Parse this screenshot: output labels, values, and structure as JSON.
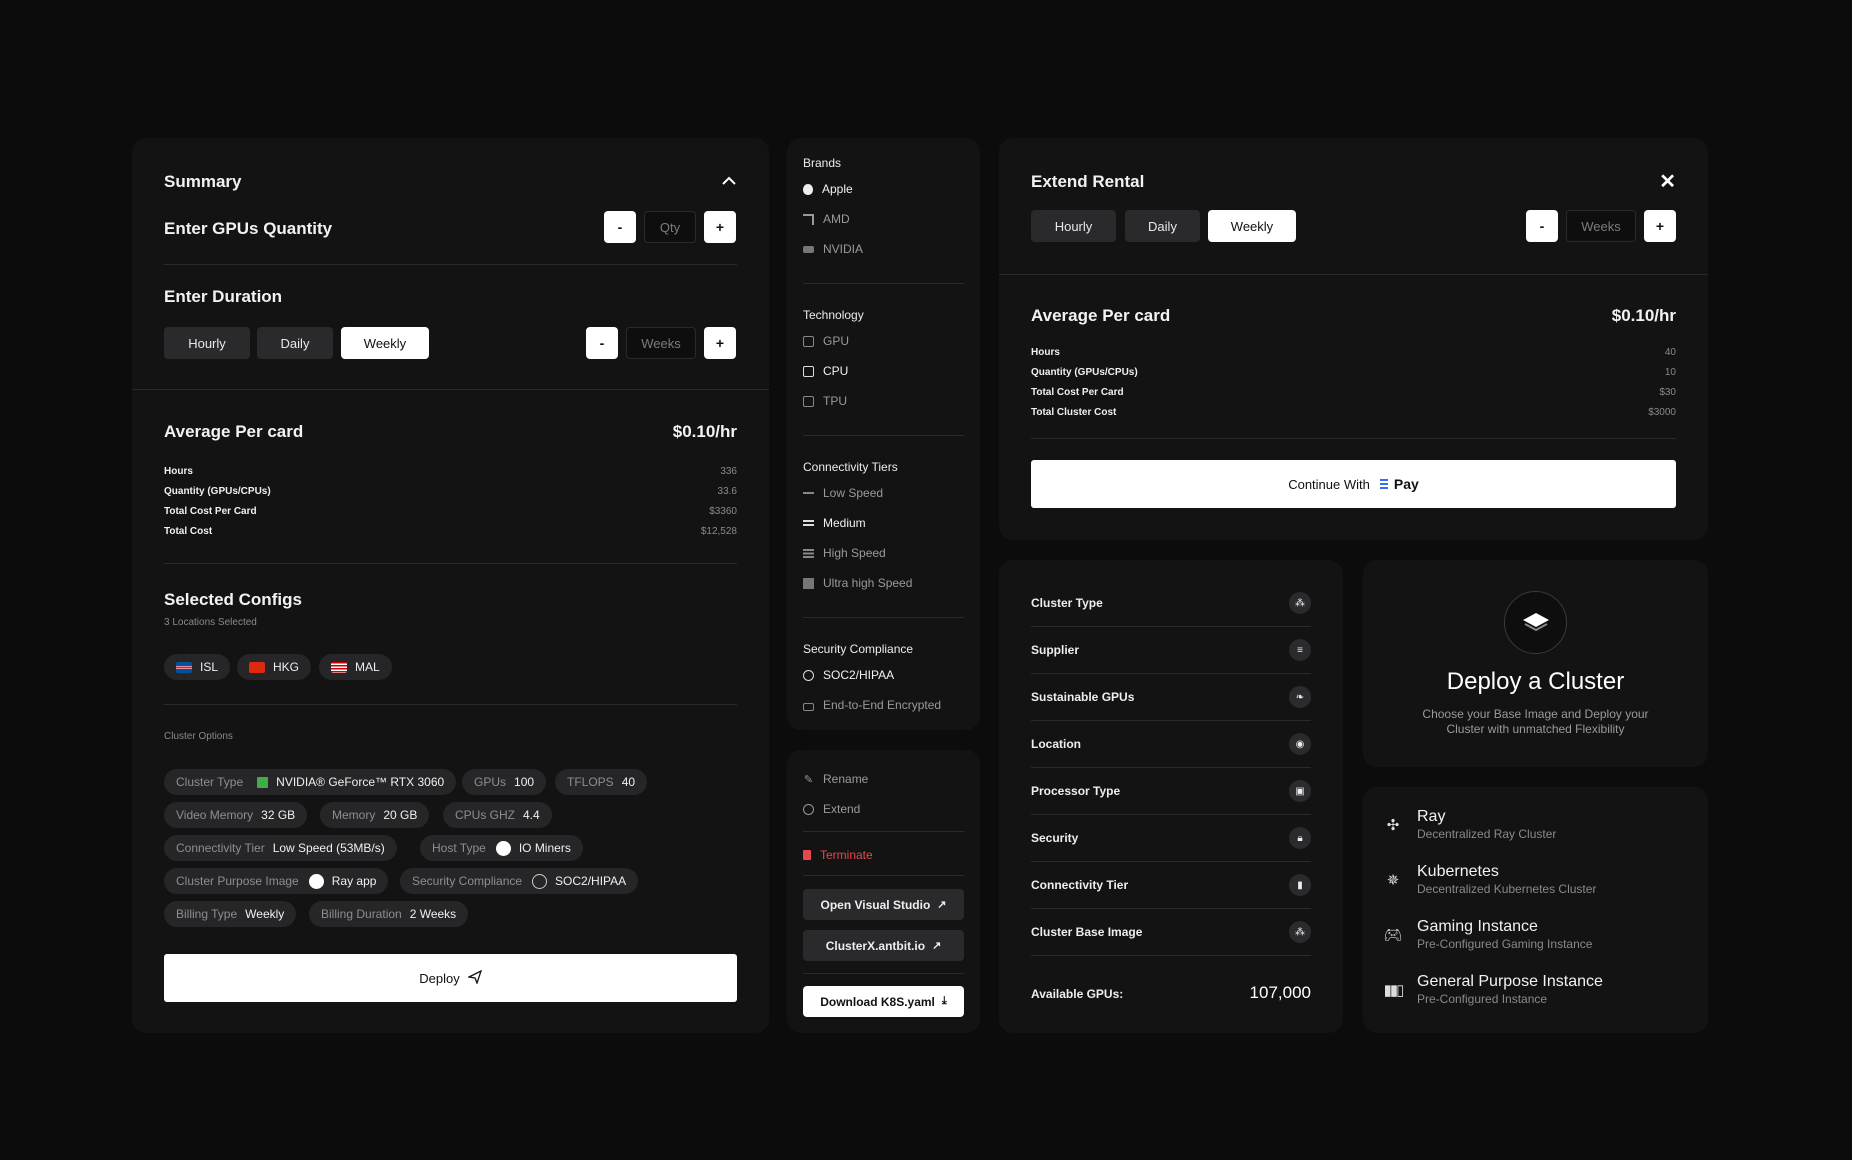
{
  "summary": {
    "title": "Summary",
    "gpu_qty_label": "Enter GPUs Quantity",
    "minus": "-",
    "plus": "+",
    "qty_placeholder": "Qty",
    "duration_label": "Enter Duration",
    "duration_tabs": [
      "Hourly",
      "Daily",
      "Weekly"
    ],
    "active_tab": "Weekly",
    "weeks_placeholder": "Weeks",
    "avg_label": "Average Per card",
    "avg_value": "$0.10/hr",
    "rows": [
      {
        "label": "Hours",
        "value": "336"
      },
      {
        "label": "Quantity (GPUs/CPUs)",
        "value": "33.6"
      },
      {
        "label": "Total Cost Per Card",
        "value": "$3360"
      },
      {
        "label": "Total Cost",
        "value": "$12,528"
      }
    ],
    "configs_title": "Selected Configs",
    "configs_sub": "3 Locations Selected",
    "locations": [
      "ISL",
      "HKG",
      "MAL"
    ],
    "cluster_options_label": "Cluster Options",
    "options": [
      {
        "k": "Cluster Type",
        "v": "NVIDIA® GeForce™ RTX 3060"
      },
      {
        "k": "GPUs",
        "v": "100"
      },
      {
        "k": "TFLOPS",
        "v": "40"
      },
      {
        "k": "Video Memory",
        "v": "32 GB"
      },
      {
        "k": "Memory",
        "v": "20 GB"
      },
      {
        "k": "CPUs GHZ",
        "v": "4.4"
      },
      {
        "k": "Connectivity Tier",
        "v": "Low Speed (53MB/s)"
      },
      {
        "k": "Host Type",
        "v": "IO Miners"
      },
      {
        "k": "Cluster Purpose Image",
        "v": "Ray app"
      },
      {
        "k": "Security Compliance",
        "v": "SOC2/HIPAA"
      },
      {
        "k": "Billing Type",
        "v": "Weekly"
      },
      {
        "k": "Billing Duration",
        "v": "2 Weeks"
      }
    ],
    "deploy_label": "Deploy"
  },
  "filters": {
    "brands_title": "Brands",
    "brands": [
      "Apple",
      "AMD",
      "NVIDIA"
    ],
    "tech_title": "Technology",
    "tech": [
      "GPU",
      "CPU",
      "TPU"
    ],
    "conn_title": "Connectivity Tiers",
    "conn": [
      "Low Speed",
      "Medium",
      "High Speed",
      "Ultra high Speed"
    ],
    "sec_title": "Security Compliance",
    "sec": [
      "SOC2/HIPAA",
      "End-to-End Encrypted"
    ]
  },
  "actions": {
    "rename": "Rename",
    "extend": "Extend",
    "terminate": "Terminate",
    "open_vs": "Open Visual Studio",
    "clusterx": "ClusterX.antbit.io",
    "download": "Download K8S.yaml"
  },
  "extend": {
    "title": "Extend Rental",
    "tabs": [
      "Hourly",
      "Daily",
      "Weekly"
    ],
    "active_tab": "Weekly",
    "minus": "-",
    "plus": "+",
    "weeks_placeholder": "Weeks",
    "avg_label": "Average Per card",
    "avg_value": "$0.10/hr",
    "rows": [
      {
        "label": "Hours",
        "value": "40"
      },
      {
        "label": "Quantity (GPUs/CPUs)",
        "value": "10"
      },
      {
        "label": "Total Cost Per Card",
        "value": "$30"
      },
      {
        "label": "Total Cluster Cost",
        "value": "$3000"
      }
    ],
    "continue_label": "Continue With",
    "pay_label": "Pay"
  },
  "cluster_list": {
    "items": [
      "Cluster Type",
      "Supplier",
      "Sustainable GPUs",
      "Location",
      "Processor Type",
      "Security",
      "Connectivity Tier",
      "Cluster Base Image"
    ],
    "available_label": "Available GPUs:",
    "available_value": "107,000"
  },
  "deploy_card": {
    "title": "Deploy a Cluster",
    "desc": "Choose your Base Image and Deploy your Cluster with unmatched Flexibility"
  },
  "apps": [
    {
      "title": "Ray",
      "sub": "Decentralized Ray Cluster",
      "icon": "ray-icon"
    },
    {
      "title": "Kubernetes",
      "sub": "Decentralized Kubernetes Cluster",
      "icon": "kubernetes-icon"
    },
    {
      "title": "Gaming Instance",
      "sub": "Pre-Configured Gaming Instance",
      "icon": "gamepad-icon"
    },
    {
      "title": "General Purpose Instance",
      "sub": "Pre-Configured Instance",
      "icon": "bars-icon"
    }
  ],
  "colors": {
    "accent": "#ffffff",
    "danger": "#e5484d",
    "card": "#131314",
    "bg": "#0c0c0d"
  }
}
